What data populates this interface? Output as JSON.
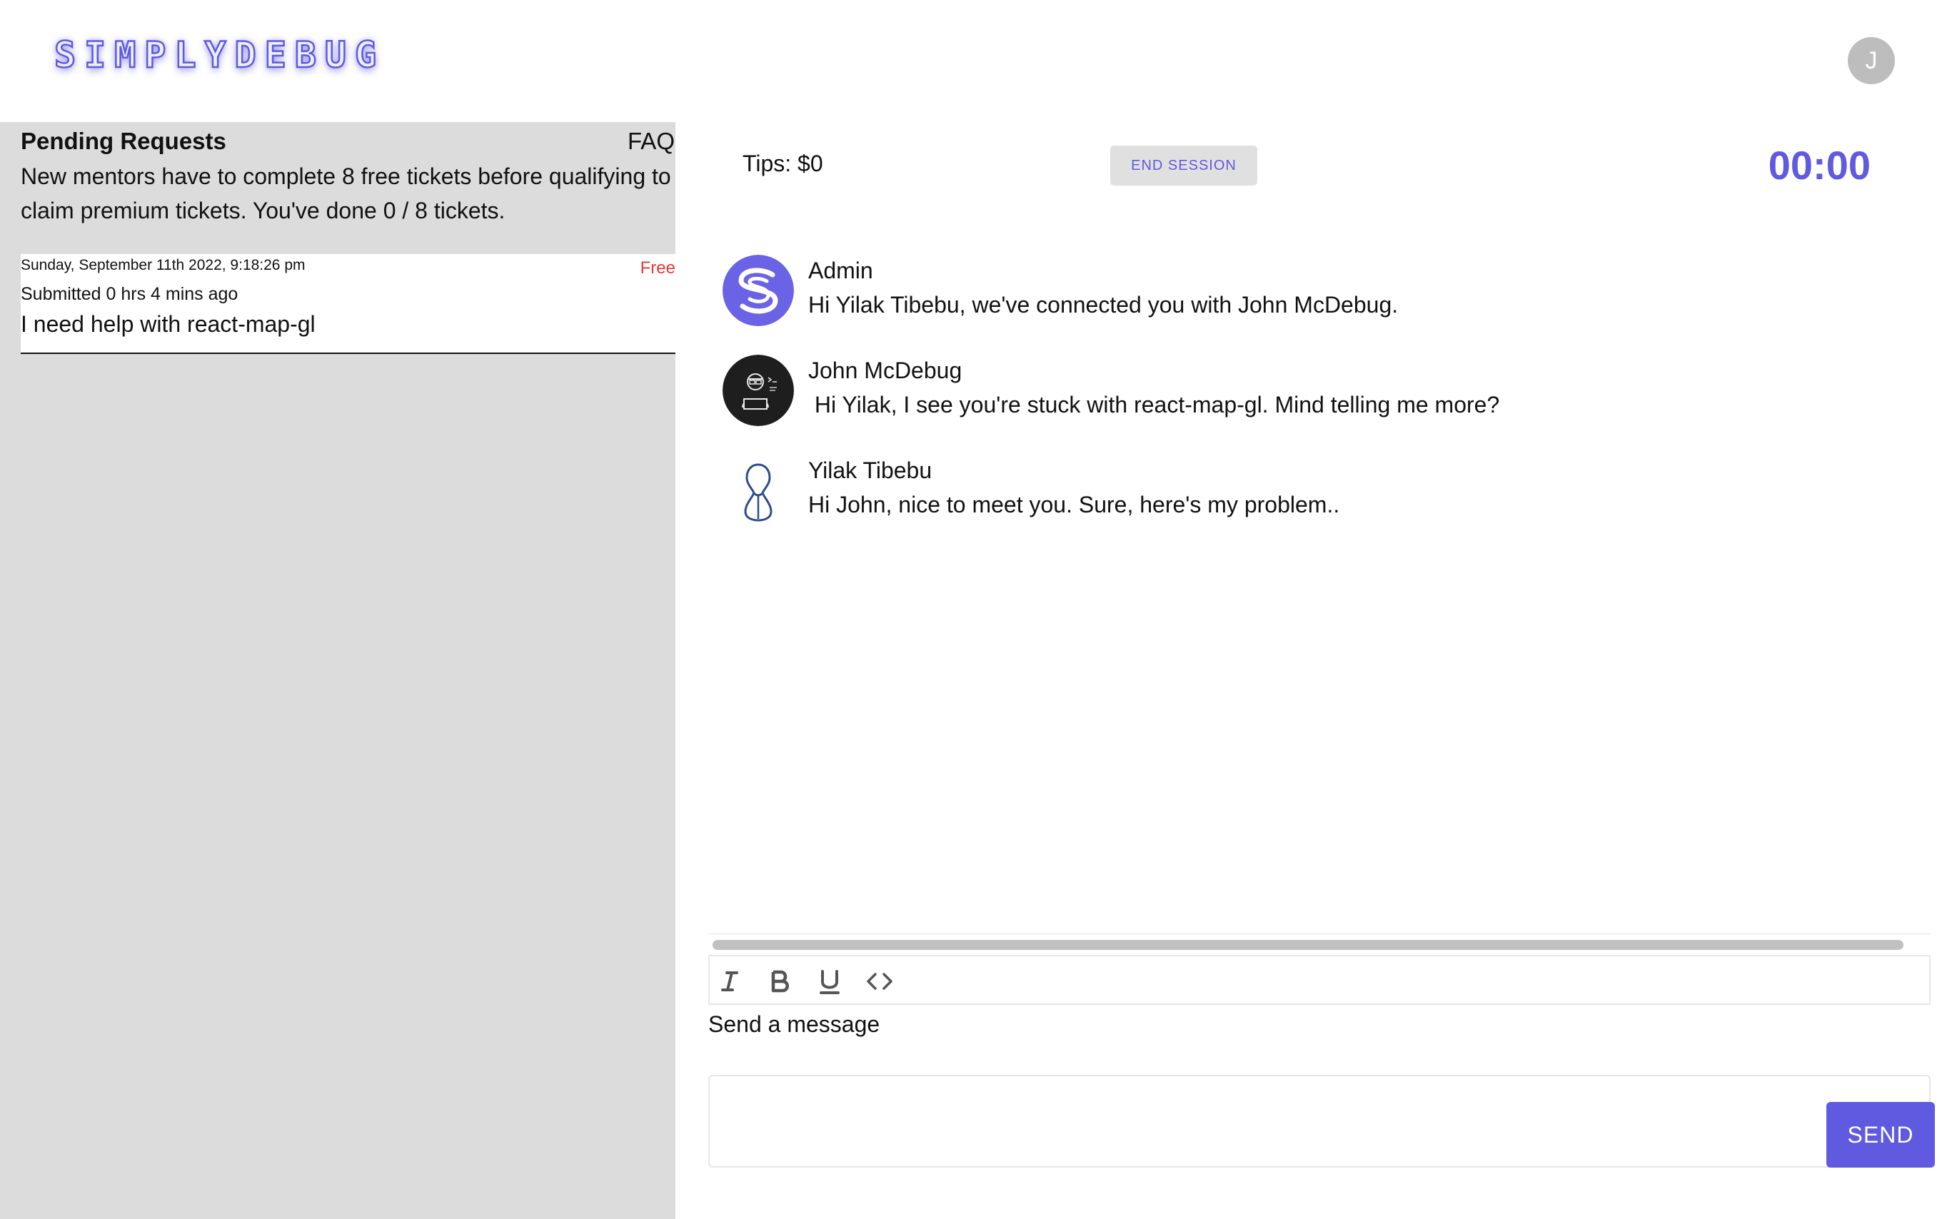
{
  "header": {
    "logo_text": "SIMPLYDEBUG",
    "user_avatar_initial": "J"
  },
  "sidebar": {
    "title": "Pending Requests",
    "faq_label": "FAQ",
    "note": "New mentors have to complete 8 free tickets before qualifying to claim premium tickets. You've done 0 / 8 tickets.",
    "tickets": [
      {
        "date": "Sunday, September 11th 2022, 9:18:26 pm",
        "badge": "Free",
        "submitted": "Submitted 0 hrs 4 mins ago",
        "title": "I need help with react-map-gl"
      }
    ]
  },
  "session": {
    "tips": "Tips: $0",
    "end_session_label": "END SESSION",
    "timer": "00:00"
  },
  "messages": [
    {
      "name": "Admin",
      "text": "Hi Yilak Tibebu, we've connected you with John McDebug.",
      "avatar_icon": "simplydebug-logo-icon"
    },
    {
      "name": "John McDebug",
      "text": " Hi Yilak, I see you're stuck with react-map-gl. Mind telling me more?",
      "avatar_icon": "developer-avatar-icon"
    },
    {
      "name": "Yilak Tibebu",
      "text": "Hi John, nice to meet you. Sure, here's my problem..",
      "avatar_icon": "person-outline-icon"
    }
  ],
  "composer": {
    "toolbar_icons": [
      "italic-icon",
      "bold-icon",
      "underline-icon",
      "code-icon"
    ],
    "label": "Send a message",
    "send_label": "SEND"
  },
  "colors": {
    "accent": "#5f5ae0",
    "sidebar_bg": "#dcdcdc",
    "badge_free": "#e53935",
    "button_gray": "#e0e0e0"
  }
}
